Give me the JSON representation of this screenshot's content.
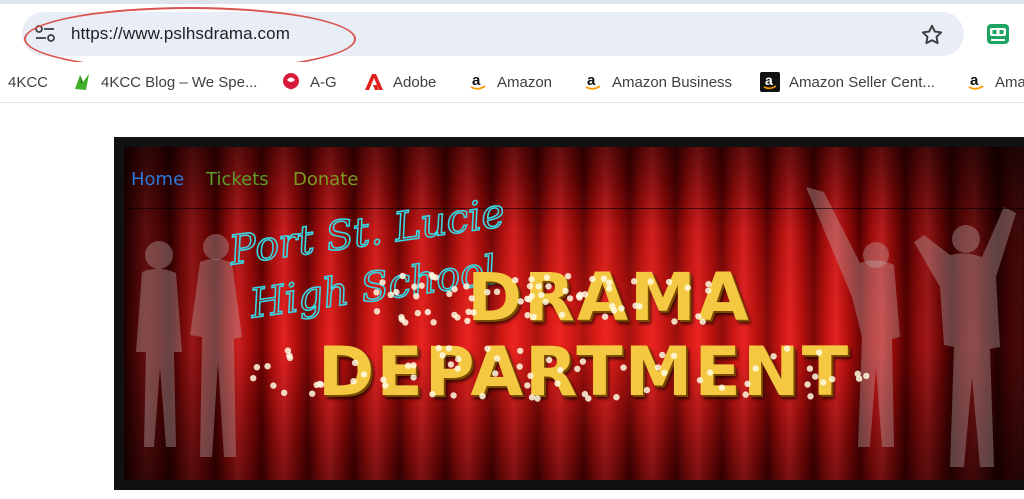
{
  "browser": {
    "url": "https://www.pslhsdrama.com",
    "icons": [
      "site-info-icon",
      "bookmark-star-icon",
      "extension-icon"
    ]
  },
  "bookmarks": [
    {
      "label": "4KCC",
      "icon": ""
    },
    {
      "label": "4KCC Blog – We Spe...",
      "icon": "4kcc-blog-icon"
    },
    {
      "label": "A-G",
      "icon": "rose-icon"
    },
    {
      "label": "Adobe",
      "icon": "adobe-icon"
    },
    {
      "label": "Amazon",
      "icon": "amazon-icon"
    },
    {
      "label": "Amazon Business",
      "icon": "amazon-icon"
    },
    {
      "label": "Amazon Seller Cent...",
      "icon": "amazon-seller-icon"
    },
    {
      "label": "Ama",
      "icon": "amazon-icon"
    }
  ],
  "site": {
    "nav": {
      "home": "Home",
      "tickets": "Tickets",
      "donate": "Donate"
    },
    "banner": {
      "script_line1": "Port St. Lucie",
      "script_line2": "High School",
      "title_line1": "DRAMA",
      "title_line2": "DEPARTMENT"
    }
  },
  "colors": {
    "annotation_circle": "#d9534f",
    "nav_home": "#2b78d6",
    "nav_tickets": "#5a9e2a",
    "nav_donate": "#7a9a20",
    "curtain": "#b80f0f",
    "marquee_letters": "#f5c842",
    "script_text": "#39d6e3"
  }
}
